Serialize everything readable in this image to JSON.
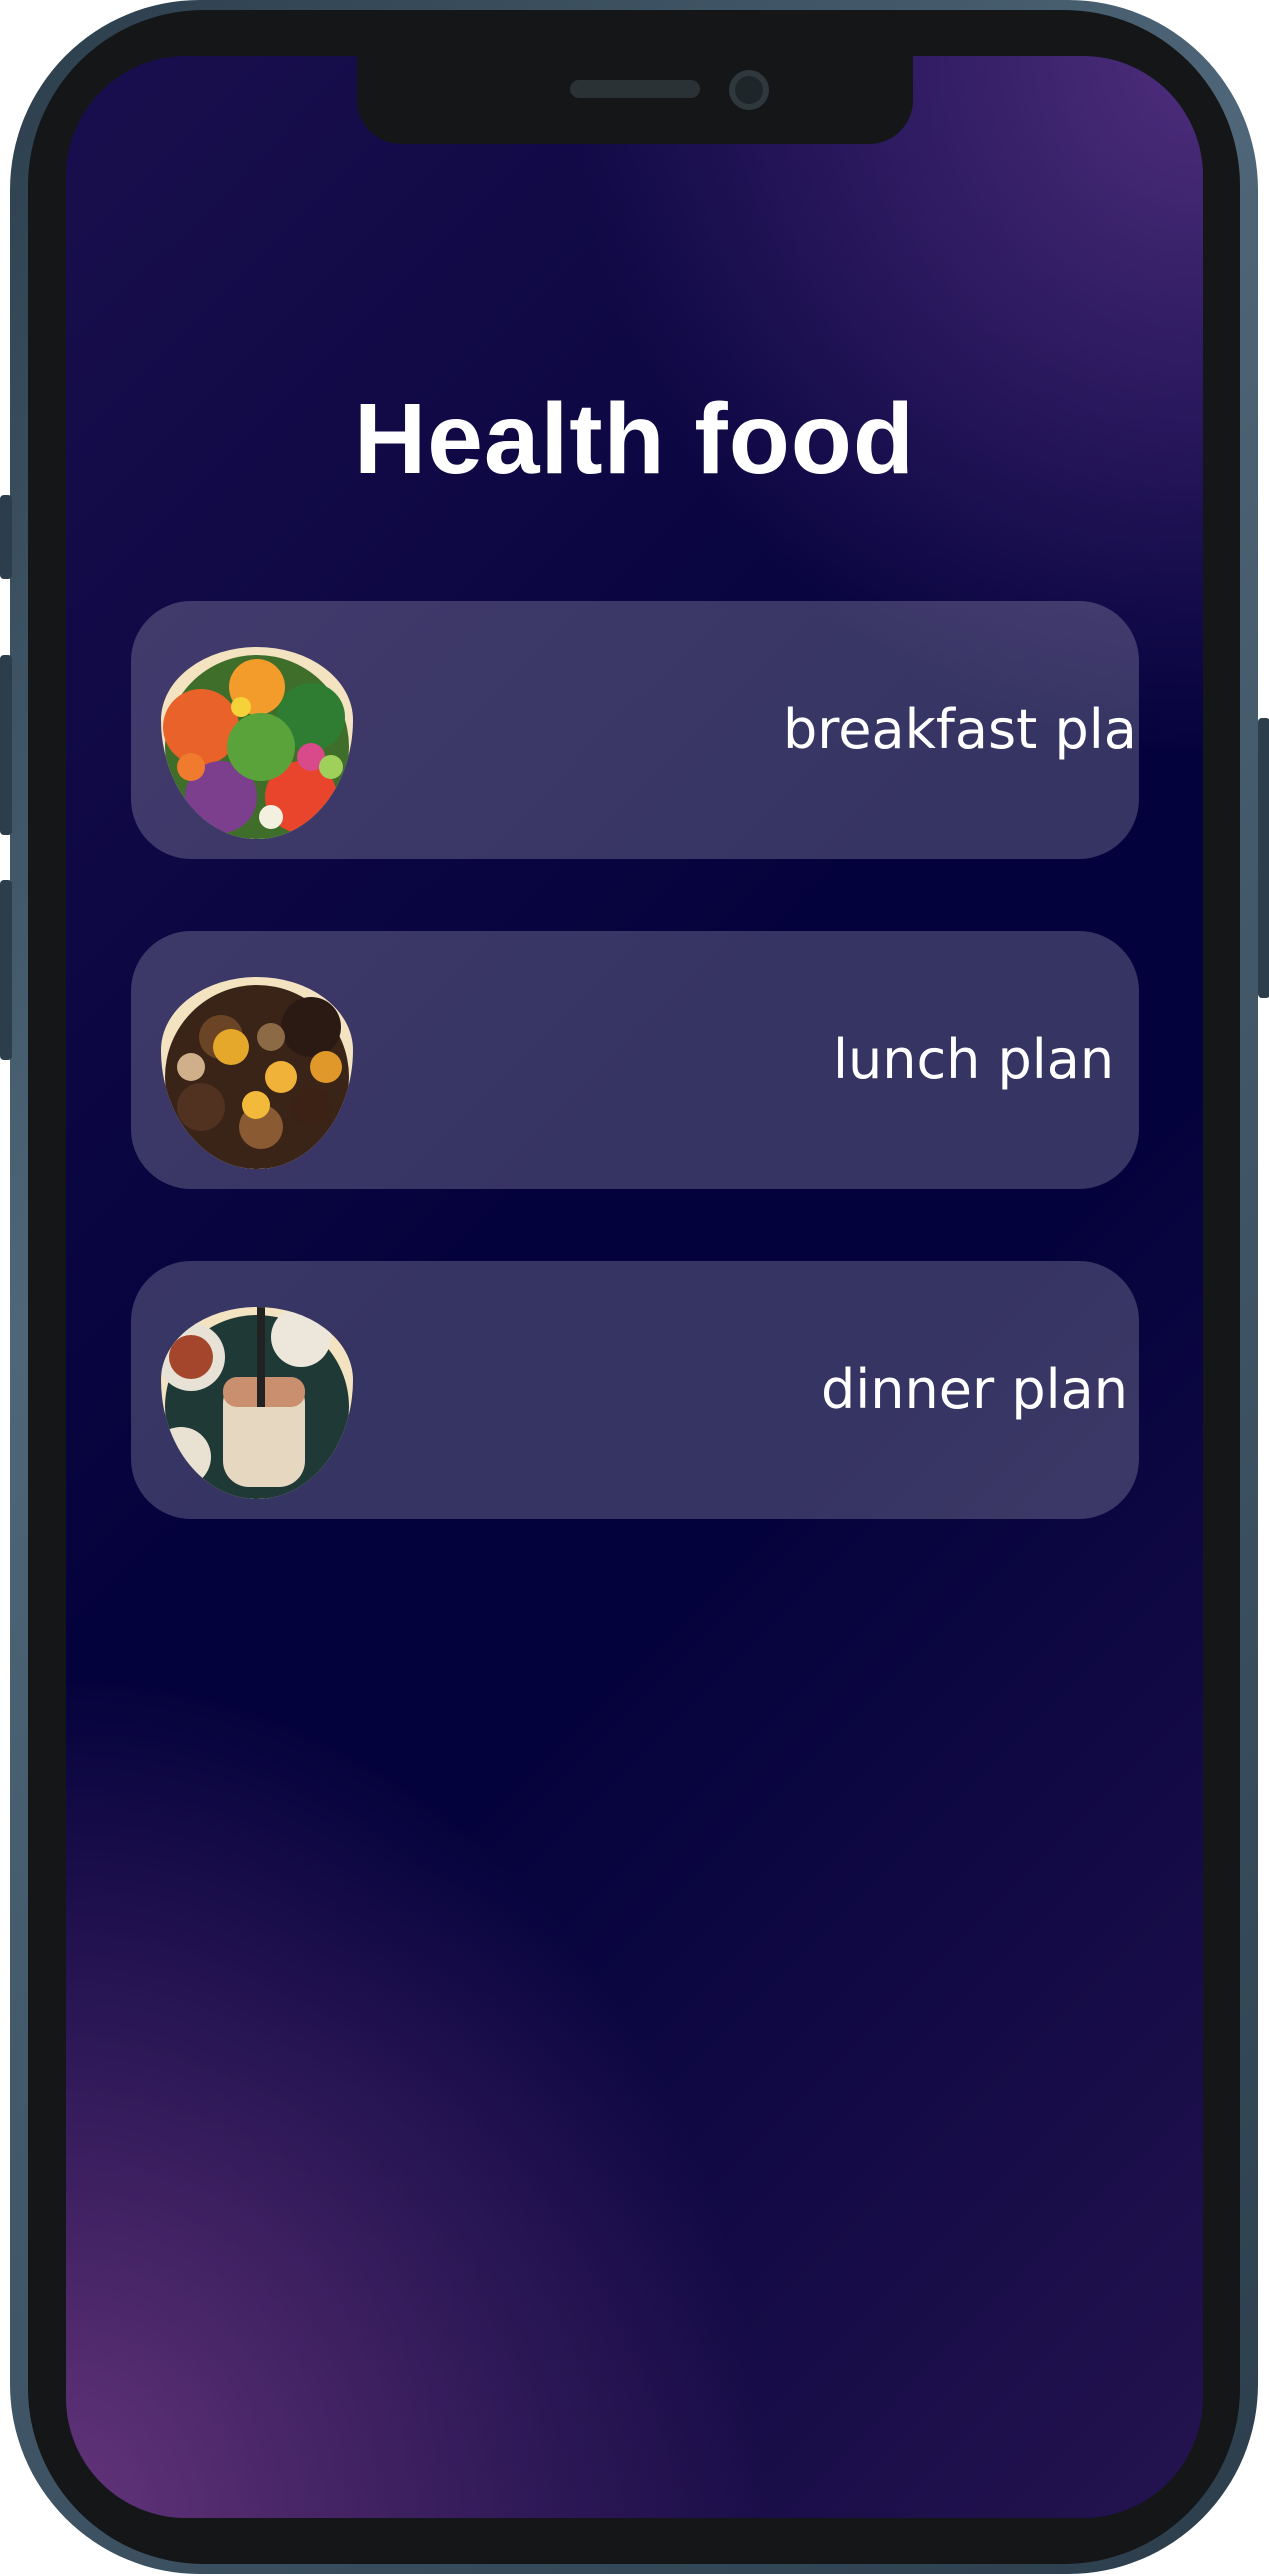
{
  "app": {
    "title": "Health food"
  },
  "plans": [
    {
      "label": "breakfast plan",
      "image": "salad-photo"
    },
    {
      "label": "lunch plan",
      "image": "nuts-dried-fruit-photo"
    },
    {
      "label": "dinner plan",
      "image": "yogurt-jar-photo"
    }
  ],
  "colors": {
    "background_dark": "#04023c",
    "background_purple": "#6a3a7e",
    "card": "rgba(255,255,255,0.20)",
    "text": "#ffffff"
  }
}
